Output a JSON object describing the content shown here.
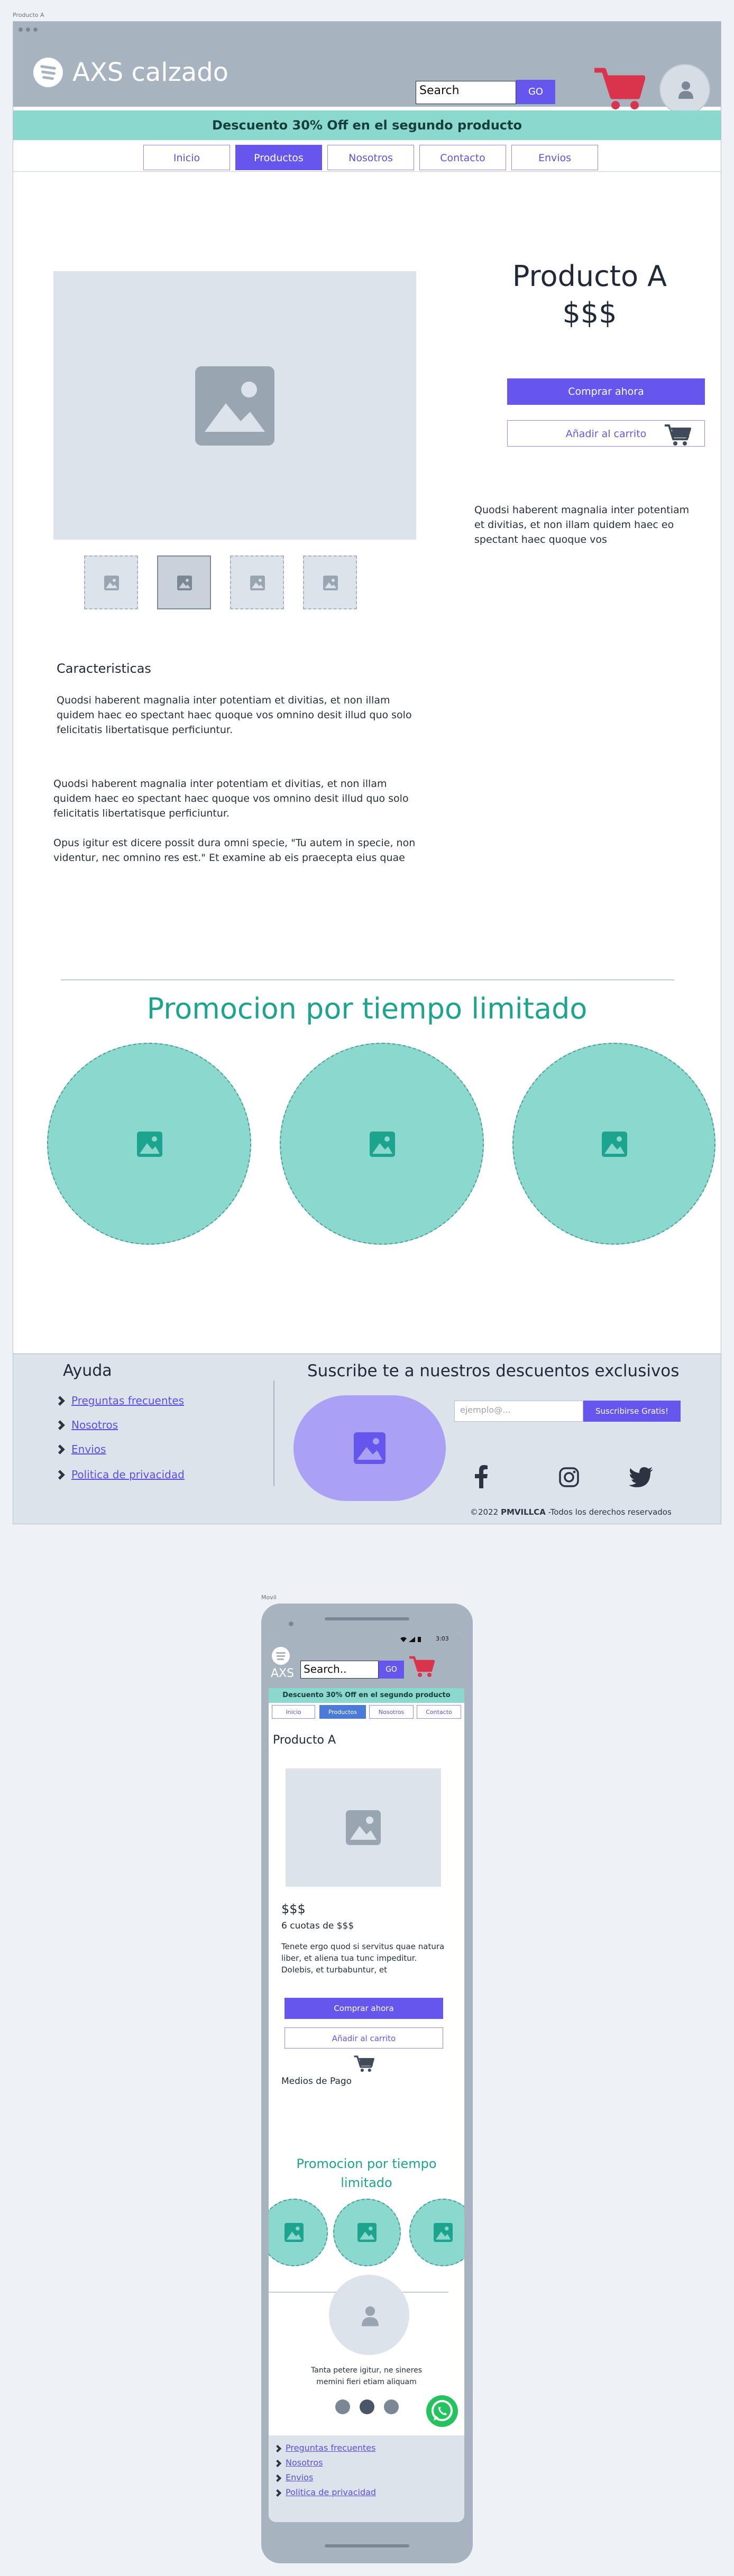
{
  "frames": {
    "desktop_label": "Producto A",
    "mobile_label": "Movil"
  },
  "brand": {
    "name": "AXS calzado"
  },
  "search": {
    "value": "Search",
    "button": "GO"
  },
  "promo_banner": "Descuento 30% Off en el segundo producto",
  "nav": [
    "Inicio",
    "Productos",
    "Nosotros",
    "Contacto",
    "Envios"
  ],
  "nav_active_index": 1,
  "product": {
    "name": "Producto A",
    "price": "$$$",
    "buy_button": "Comprar ahora",
    "cart_button": "Añadir al carrito",
    "side_text": "Quodsi haberent magnalia inter potentiam et divitias, et non illam quidem haec eo spectant haec quoque vos",
    "features_title": "Caracteristicas",
    "features_text": "Quodsi haberent magnalia inter potentiam et divitias, et non illam quidem haec eo spectant haec quoque vos omnino desit illud quo solo felicitatis libertatisque perficiuntur.",
    "body_text_1": "Quodsi haberent magnalia inter potentiam et divitias, et non illam quidem haec eo spectant haec quoque vos omnino desit illud quo solo felicitatis libertatisque perficiuntur.",
    "body_text_2": "Opus igitur est dicere possit dura omni specie, \"Tu autem in specie, non videntur, nec omnino res est.\" Et examine ab eis praecepta eius quae"
  },
  "promo_section": {
    "title": "Promocion  por tiempo limitado"
  },
  "footer": {
    "help_title": "Ayuda",
    "links": [
      "Preguntas frecuentes",
      "Nosotros",
      "Envios",
      "Politica de privacidad"
    ],
    "subscribe_title": "Suscribe te a nuestros descuentos exclusivos",
    "email_placeholder": "ejemplo@...",
    "subscribe_button": "Suscribirse Gratis!",
    "copyright_prefix": "©2022 ",
    "copyright_author": "PMVILLCA",
    "copyright_suffix": " -Todos los derechos reservados"
  },
  "mobile": {
    "time": "3:03",
    "search_value": "Search..",
    "search_button": "GO",
    "brand_short": "AXS",
    "promo_banner": "Descuento 30% Off en el segundo producto",
    "nav": [
      "Inicio",
      "Productos",
      "Nosotros",
      "Contacto"
    ],
    "product_name": "Producto A",
    "price": "$$$",
    "installments": "6 cuotas de $$$",
    "description": "Tenete ergo quod si servitus quae natura liber, et aliena tua tunc impeditur. Dolebis, et turbabuntur, et",
    "buy_button": "Comprar ahora",
    "cart_button": "Añadir al carrito",
    "payment_label": "Medios de Pago",
    "promo_title": "Promocion  por tiempo limitado",
    "testimonial": "Tanta petere igitur, ne sineres memini fieri etiam aliquam",
    "carousel_active_index": 1,
    "links": [
      "Preguntas frecuentes",
      "Nosotros",
      "Envios",
      "Politica de privacidad"
    ]
  },
  "colors": {
    "primary": "#6557ee",
    "teal": "#8ad8ce",
    "teal_dark": "#1da48f",
    "chrome": "#a8b3c0",
    "cart_red": "#d9344b",
    "whatsapp": "#25c35f"
  }
}
